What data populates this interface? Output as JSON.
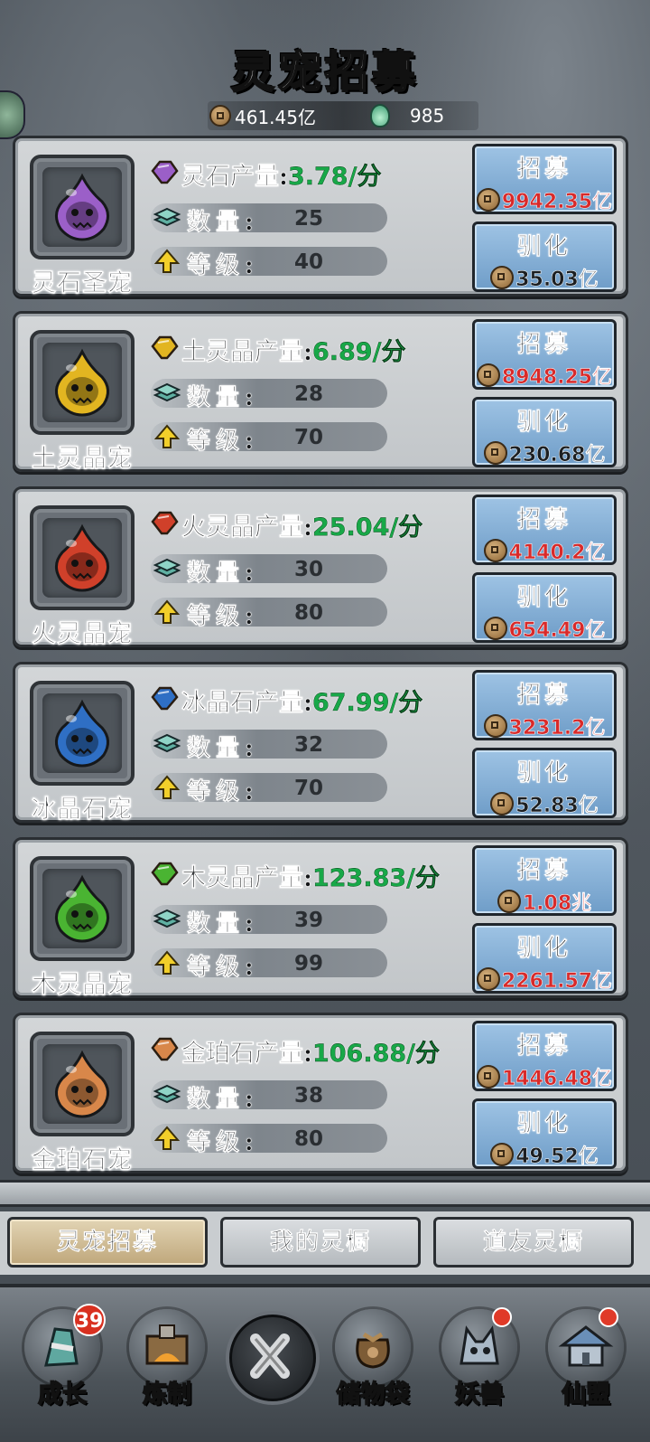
{
  "title": "灵宠招募",
  "currency": {
    "coins": "461.45亿",
    "jade": "985"
  },
  "cards": [
    {
      "pet_name": "灵石圣宠",
      "resource": "灵石产量:",
      "rate": "3.78/分",
      "qty_label": "数量:",
      "qty": "25",
      "lvl_label": "等级:",
      "lvl": "40",
      "recruit_label": "招募",
      "recruit_cost": "9942.35亿",
      "recruit_red": true,
      "tame_label": "驯化",
      "tame_cost": "35.03亿",
      "tame_red": false,
      "color": "#9b5fc8"
    },
    {
      "pet_name": "土灵晶宠",
      "resource": "土灵晶产量:",
      "rate": "6.89/分",
      "qty_label": "数量:",
      "qty": "28",
      "lvl_label": "等级:",
      "lvl": "70",
      "recruit_label": "招募",
      "recruit_cost": "8948.25亿",
      "recruit_red": true,
      "tame_label": "驯化",
      "tame_cost": "230.68亿",
      "tame_red": false,
      "color": "#e2b521"
    },
    {
      "pet_name": "火灵晶宠",
      "resource": "火灵晶产量:",
      "rate": "25.04/分",
      "qty_label": "数量:",
      "qty": "30",
      "lvl_label": "等级:",
      "lvl": "80",
      "recruit_label": "招募",
      "recruit_cost": "4140.2亿",
      "recruit_red": true,
      "tame_label": "驯化",
      "tame_cost": "654.49亿",
      "tame_red": true,
      "color": "#d0402a"
    },
    {
      "pet_name": "冰晶石宠",
      "resource": "冰晶石产量:",
      "rate": "67.99/分",
      "qty_label": "数量:",
      "qty": "32",
      "lvl_label": "等级:",
      "lvl": "70",
      "recruit_label": "招募",
      "recruit_cost": "3231.2亿",
      "recruit_red": true,
      "tame_label": "驯化",
      "tame_cost": "52.83亿",
      "tame_red": false,
      "color": "#2f6fc4"
    },
    {
      "pet_name": "木灵晶宠",
      "resource": "木灵晶产量:",
      "rate": "123.83/分",
      "qty_label": "数量:",
      "qty": "39",
      "lvl_label": "等级:",
      "lvl": "99",
      "recruit_label": "招募",
      "recruit_cost": "1.08兆",
      "recruit_red": true,
      "tame_label": "驯化",
      "tame_cost": "2261.57亿",
      "tame_red": true,
      "color": "#4ab432"
    },
    {
      "pet_name": "金珀石宠",
      "resource": "金珀石产量:",
      "rate": "106.88/分",
      "qty_label": "数量:",
      "qty": "38",
      "lvl_label": "等级:",
      "lvl": "80",
      "recruit_label": "招募",
      "recruit_cost": "1446.48亿",
      "recruit_red": true,
      "tame_label": "驯化",
      "tame_cost": "49.52亿",
      "tame_red": false,
      "color": "#d8874a"
    }
  ],
  "tabs": [
    {
      "label": "灵宠招募",
      "active": true
    },
    {
      "label": "我的灵橱",
      "active": false
    },
    {
      "label": "道友灵橱",
      "active": false
    }
  ],
  "nav": [
    {
      "label": "成长",
      "icon": "growth-icon",
      "badge": "39"
    },
    {
      "label": "炼制",
      "icon": "forge-icon"
    },
    {
      "label": "",
      "icon": "close-icon"
    },
    {
      "label": "储物袋",
      "icon": "storage-bag-icon"
    },
    {
      "label": "妖兽",
      "icon": "beast-icon"
    },
    {
      "label": "仙盟",
      "icon": "alliance-icon"
    }
  ]
}
